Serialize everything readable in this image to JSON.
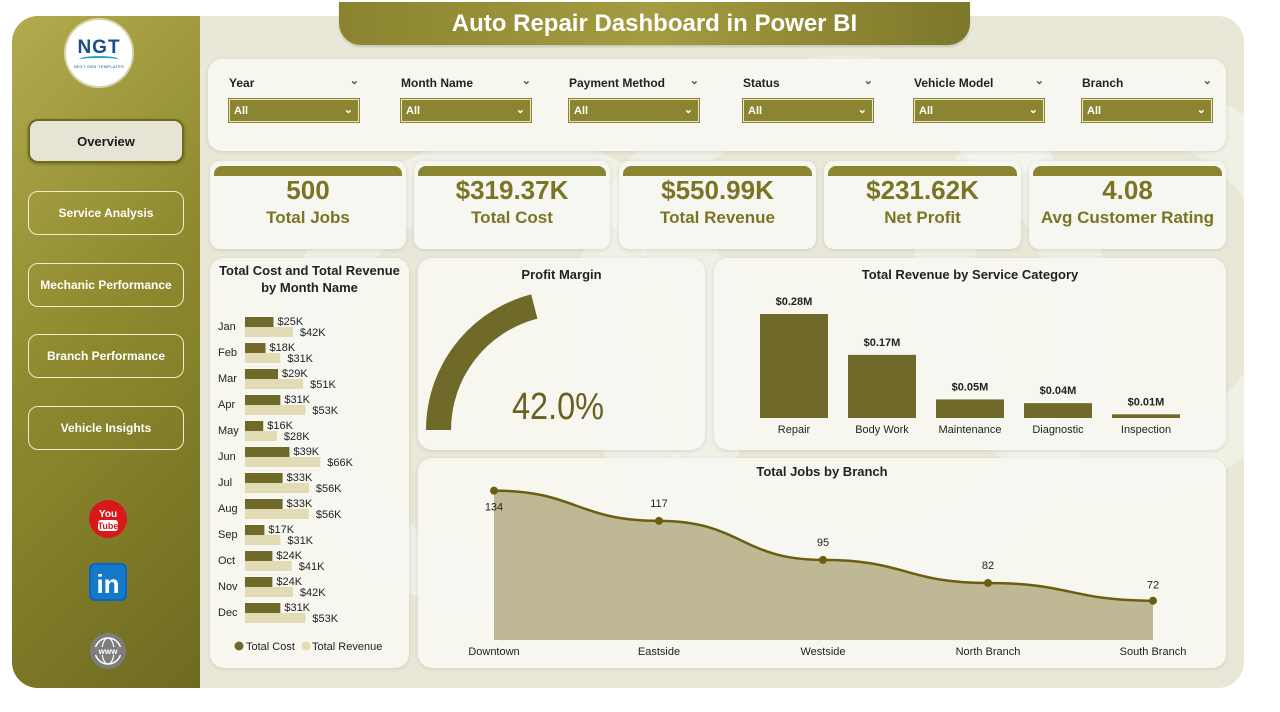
{
  "title": "Auto Repair Dashboard in Power BI",
  "logo": {
    "mark": "NGT",
    "sub": "NEXT GEN TEMPLATES"
  },
  "nav": [
    {
      "label": "Overview",
      "active": true
    },
    {
      "label": "Service Analysis",
      "active": false
    },
    {
      "label": "Mechanic Performance",
      "active": false
    },
    {
      "label": "Branch Performance",
      "active": false
    },
    {
      "label": "Vehicle Insights",
      "active": false
    }
  ],
  "social": [
    {
      "icon": "youtube-icon",
      "label": "You Tube"
    },
    {
      "icon": "linkedin-icon",
      "label": "in"
    },
    {
      "icon": "www-icon",
      "label": "www"
    }
  ],
  "filters": [
    {
      "label": "Year",
      "value": "All"
    },
    {
      "label": "Month Name",
      "value": "All"
    },
    {
      "label": "Payment Method",
      "value": "All"
    },
    {
      "label": "Status",
      "value": "All"
    },
    {
      "label": "Vehicle Model",
      "value": "All"
    },
    {
      "label": "Branch",
      "value": "All"
    }
  ],
  "kpis": [
    {
      "value": "500",
      "label": "Total Jobs"
    },
    {
      "value": "$319.37K",
      "label": "Total Cost"
    },
    {
      "value": "$550.99K",
      "label": "Total Revenue"
    },
    {
      "value": "$231.62K",
      "label": "Net Profit"
    },
    {
      "value": "4.08",
      "label": "Avg Customer Rating"
    }
  ],
  "colors": {
    "accent": "#8b8430",
    "dark": "#6f6a2a",
    "light": "#e2dcb6",
    "area": "#bfb894",
    "line": "#6b5e10"
  },
  "chart_data": [
    {
      "type": "bar",
      "orientation": "horizontal",
      "title": "Total Cost and Total Revenue by Month Name",
      "categories": [
        "Jan",
        "Feb",
        "Mar",
        "Apr",
        "May",
        "Jun",
        "Jul",
        "Aug",
        "Sep",
        "Oct",
        "Nov",
        "Dec"
      ],
      "series": [
        {
          "name": "Total Cost",
          "values": [
            25,
            18,
            29,
            31,
            16,
            39,
            33,
            33,
            17,
            24,
            24,
            31
          ],
          "labels": [
            "$25K",
            "$18K",
            "$29K",
            "$31K",
            "$16K",
            "$39K",
            "$33K",
            "$33K",
            "$17K",
            "$24K",
            "$24K",
            "$31K"
          ]
        },
        {
          "name": "Total Revenue",
          "values": [
            42,
            31,
            51,
            53,
            28,
            66,
            56,
            56,
            31,
            41,
            42,
            53
          ],
          "labels": [
            "$42K",
            "$31K",
            "$51K",
            "$53K",
            "$28K",
            "$66K",
            "$56K",
            "$56K",
            "$31K",
            "$41K",
            "$42K",
            "$53K"
          ]
        }
      ],
      "legend": "bottom"
    },
    {
      "type": "gauge",
      "title": "Profit Margin",
      "value": 42.0,
      "label": "42.0%",
      "range": [
        0,
        100
      ]
    },
    {
      "type": "bar",
      "title": "Total Revenue by Service Category",
      "categories": [
        "Repair",
        "Body Work",
        "Maintenance",
        "Diagnostic",
        "Inspection"
      ],
      "values": [
        0.28,
        0.17,
        0.05,
        0.04,
        0.01
      ],
      "labels": [
        "$0.28M",
        "$0.17M",
        "$0.05M",
        "$0.04M",
        "$0.01M"
      ]
    },
    {
      "type": "area",
      "title": "Total Jobs by Branch",
      "categories": [
        "Downtown",
        "Eastside",
        "Westside",
        "North Branch",
        "South Branch"
      ],
      "values": [
        134,
        117,
        95,
        82,
        72
      ]
    }
  ]
}
